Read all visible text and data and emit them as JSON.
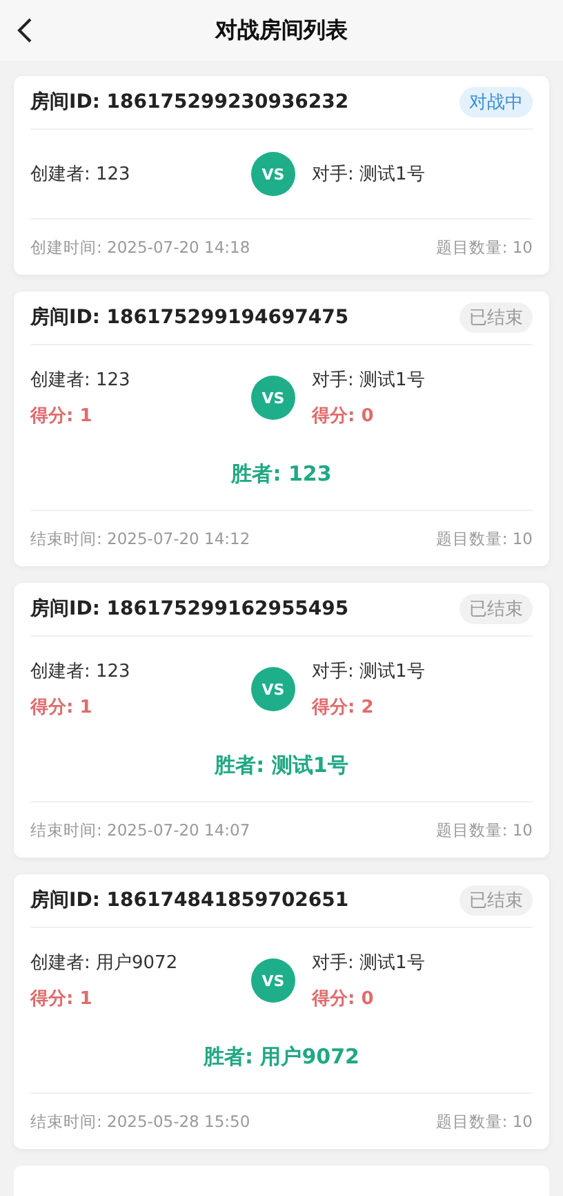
{
  "header": {
    "title": "对战房间列表"
  },
  "rooms": [
    {
      "room_id": "房间ID: 186175299230936232",
      "status": {
        "kind": "ongoing",
        "label": "对战中"
      },
      "creator": "创建者: 123",
      "opponent": "对手: 测试1号",
      "vs": "VS",
      "time": "创建时间: 2025-07-20 14:18",
      "questions": "题目数量: 10"
    },
    {
      "room_id": "房间ID: 186175299194697475",
      "status": {
        "kind": "ended",
        "label": "已结束"
      },
      "creator": "创建者: 123",
      "creator_score": "得分: 1",
      "opponent": "对手: 测试1号",
      "opponent_score": "得分: 0",
      "vs": "VS",
      "winner": "胜者: 123",
      "time": "结束时间: 2025-07-20 14:12",
      "questions": "题目数量: 10"
    },
    {
      "room_id": "房间ID: 186175299162955495",
      "status": {
        "kind": "ended",
        "label": "已结束"
      },
      "creator": "创建者: 123",
      "creator_score": "得分: 1",
      "opponent": "对手: 测试1号",
      "opponent_score": "得分: 2",
      "vs": "VS",
      "winner": "胜者: 测试1号",
      "time": "结束时间: 2025-07-20 14:07",
      "questions": "题目数量: 10"
    },
    {
      "room_id": "房间ID: 186174841859702651",
      "status": {
        "kind": "ended",
        "label": "已结束"
      },
      "creator": "创建者: 用户9072",
      "creator_score": "得分: 1",
      "opponent": "对手: 测试1号",
      "opponent_score": "得分: 0",
      "vs": "VS",
      "winner": "胜者: 用户9072",
      "time": "结束时间: 2025-05-28 15:50",
      "questions": "题目数量: 10"
    }
  ]
}
